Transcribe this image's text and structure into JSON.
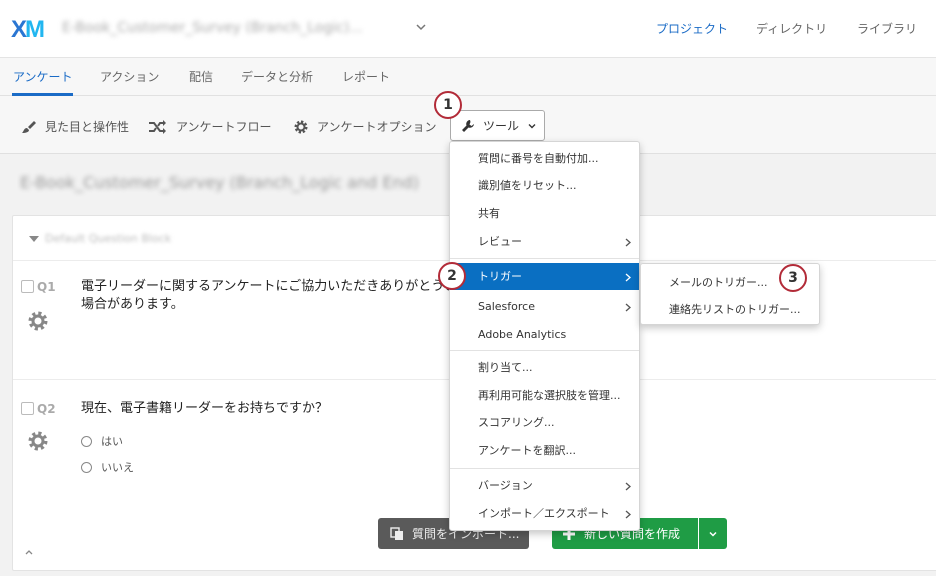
{
  "header": {
    "logo": "XM",
    "project_title": "E-Book_Customer_Survey (Branch_Logic)...",
    "nav": [
      "プロジェクト",
      "ディレクトリ",
      "ライブラリ"
    ]
  },
  "tabs": [
    "アンケート",
    "アクション",
    "配信",
    "データと分析",
    "レポート"
  ],
  "toolbar": {
    "look_and_feel": "見た目と操作性",
    "survey_flow": "アンケートフロー",
    "survey_options": "アンケートオプション",
    "tools": "ツール"
  },
  "survey": {
    "title": "E-Book_Customer_Survey (Branch_Logic and End)",
    "block_name": "Default Question Block",
    "questions": [
      {
        "num": "Q1",
        "text_line1": "電子リーダーに関するアンケートにご協力いただきありがとうご",
        "text_line2": "場合があります。"
      },
      {
        "num": "Q2",
        "text": "現在、電子書籍リーダーをお持ちですか？",
        "choices": [
          "はい",
          "いいえ"
        ]
      }
    ],
    "import_button": "質問をインポート...",
    "new_question_button": "新しい質問を作成"
  },
  "menu": {
    "items": [
      "質問に番号を自動付加...",
      "識別値をリセット...",
      "共有",
      "レビュー",
      "トリガー",
      "Salesforce",
      "Adobe Analytics",
      "割り当て...",
      "再利用可能な選択肢を管理...",
      "スコアリング...",
      "アンケートを翻訳...",
      "バージョン",
      "インポート／エクスポート"
    ],
    "submenu": [
      "メールのトリガー...",
      "連絡先リストのトリガー..."
    ]
  },
  "badges": [
    "1",
    "2",
    "3"
  ],
  "colors": {
    "accent": "#1a6bc6",
    "highlight": "#0a6fc2",
    "green": "#1f9c45",
    "badge_border": "#b22b38"
  }
}
